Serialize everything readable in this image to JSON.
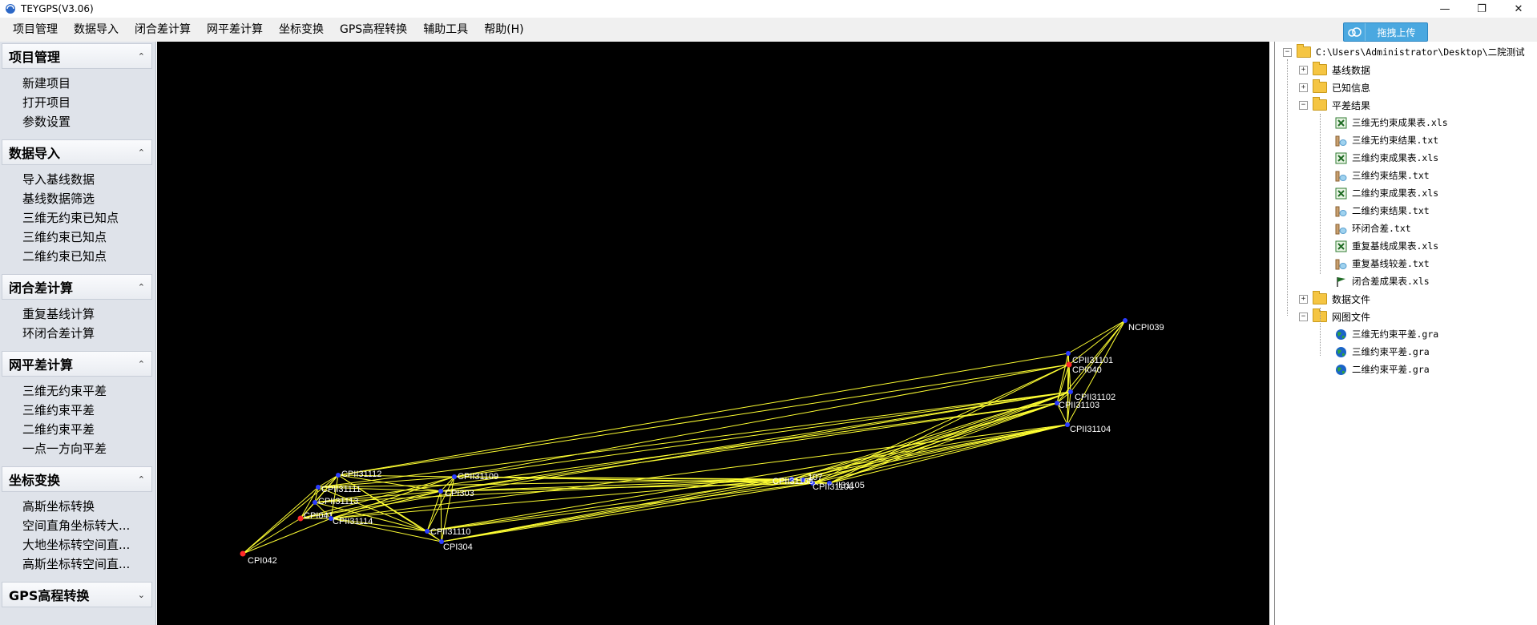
{
  "window": {
    "title": "TEYGPS(V3.06)",
    "controls": [
      "minimize",
      "maximize",
      "close"
    ]
  },
  "menubar": {
    "items": [
      "项目管理",
      "数据导入",
      "闭合差计算",
      "网平差计算",
      "坐标变换",
      "GPS高程转换",
      "辅助工具",
      "帮助(H)"
    ],
    "upload_label": "拖拽上传"
  },
  "sidebar": {
    "sections": [
      {
        "title": "项目管理",
        "items": [
          "新建项目",
          "打开项目",
          "参数设置"
        ]
      },
      {
        "title": "数据导入",
        "items": [
          "导入基线数据",
          "基线数据筛选",
          "三维无约束已知点",
          "三维约束已知点",
          "二维约束已知点"
        ]
      },
      {
        "title": "闭合差计算",
        "items": [
          "重复基线计算",
          "环闭合差计算"
        ]
      },
      {
        "title": "网平差计算",
        "items": [
          "三维无约束平差",
          "三维约束平差",
          "二维约束平差",
          "一点一方向平差"
        ]
      },
      {
        "title": "坐标变换",
        "items": [
          "高斯坐标转换",
          "空间直角坐标转大...",
          "大地坐标转空间直...",
          "高斯坐标转空间直..."
        ]
      },
      {
        "title": "GPS高程转换",
        "items": []
      }
    ]
  },
  "tree": {
    "root": "C:\\Users\\Administrator\\Desktop\\二院测试",
    "nodes": [
      {
        "label": "基线数据",
        "kind": "folder",
        "level": 1,
        "expander": "+"
      },
      {
        "label": "已知信息",
        "kind": "folder",
        "level": 1,
        "expander": "+"
      },
      {
        "label": "平差结果",
        "kind": "folder",
        "level": 1,
        "expander": "-"
      },
      {
        "label": "三维无约束成果表.xls",
        "kind": "xls",
        "level": 2
      },
      {
        "label": "三维无约束结果.txt",
        "kind": "txt",
        "level": 2
      },
      {
        "label": "三维约束成果表.xls",
        "kind": "xls",
        "level": 2
      },
      {
        "label": "三维约束结果.txt",
        "kind": "txt",
        "level": 2
      },
      {
        "label": "二维约束成果表.xls",
        "kind": "xls",
        "level": 2
      },
      {
        "label": "二维约束结果.txt",
        "kind": "txt",
        "level": 2
      },
      {
        "label": "环闭合差.txt",
        "kind": "txt",
        "level": 2
      },
      {
        "label": "重复基线成果表.xls",
        "kind": "xls",
        "level": 2
      },
      {
        "label": "重复基线较差.txt",
        "kind": "txt",
        "level": 2
      },
      {
        "label": "闭合差成果表.xls",
        "kind": "flag",
        "level": 2
      },
      {
        "label": "数据文件",
        "kind": "folder",
        "level": 1,
        "expander": "+"
      },
      {
        "label": "网图文件",
        "kind": "folder",
        "level": 1,
        "expander": "-"
      },
      {
        "label": "三维无约束平差.gra",
        "kind": "globe",
        "level": 2
      },
      {
        "label": "三维约束平差.gra",
        "kind": "globe",
        "level": 2
      },
      {
        "label": "二维约束平差.gra",
        "kind": "globe",
        "level": 2
      }
    ]
  },
  "network": {
    "line_color": "#ffff33",
    "known_point_color": "#ff2a2a",
    "unknown_point_color": "#2a3cff",
    "label_color": "#ffffff",
    "points": [
      {
        "id": "NCPI039",
        "label": "NCPI039",
        "known": false
      },
      {
        "id": "CPII31101",
        "label": "CPII31101",
        "known": false
      },
      {
        "id": "CPI040",
        "label": "CPI040",
        "known": true
      },
      {
        "id": "CPII31102",
        "label": "CPII31102",
        "known": false
      },
      {
        "id": "CPII31103",
        "label": "CPII31103",
        "known": false
      },
      {
        "id": "CPII31104",
        "label": "CPII31104",
        "known": false
      },
      {
        "id": "CPII31105",
        "label": "II31105",
        "known": false
      },
      {
        "id": "CPII31106",
        "label": "CPII31106",
        "known": false
      },
      {
        "id": "CPII31107",
        "label": "107",
        "known": false
      },
      {
        "id": "CPII31108",
        "label": "CPII31108",
        "known": false
      },
      {
        "id": "CPII31109",
        "label": "CPII31109",
        "known": false
      },
      {
        "id": "CPI303",
        "label": "CPI303",
        "known": false
      },
      {
        "id": "CPII31110",
        "label": "CPII31110",
        "known": false
      },
      {
        "id": "CPI304",
        "label": "CPI304",
        "known": false
      },
      {
        "id": "CPII31112",
        "label": "CPII31112",
        "known": false
      },
      {
        "id": "CPII31111",
        "label": "CPII31111",
        "known": false
      },
      {
        "id": "CPII31113",
        "label": "CPII31113",
        "known": false
      },
      {
        "id": "CPI041",
        "label": "CPI041",
        "known": true
      },
      {
        "id": "CPII31114",
        "label": "CPII31114",
        "known": false
      },
      {
        "id": "CPI042",
        "label": "CPI042",
        "known": true
      }
    ],
    "baselines": [
      [
        "CPI042",
        "CPI041"
      ],
      [
        "CPI042",
        "CPII31111"
      ],
      [
        "CPI042",
        "CPII31112"
      ],
      [
        "CPI042",
        "CPII31114"
      ],
      [
        "CPI041",
        "CPII31111"
      ],
      [
        "CPI041",
        "CPII31112"
      ],
      [
        "CPI041",
        "CPII31113"
      ],
      [
        "CPI041",
        "CPII31114"
      ],
      [
        "CPI041",
        "CPI303"
      ],
      [
        "CPI041",
        "CPII31109"
      ],
      [
        "CPII31111",
        "CPII31112"
      ],
      [
        "CPII31111",
        "CPII31113"
      ],
      [
        "CPII31111",
        "CPI303"
      ],
      [
        "CPII31111",
        "CPII31109"
      ],
      [
        "CPII31111",
        "CPII31110"
      ],
      [
        "CPII31112",
        "CPII31113"
      ],
      [
        "CPII31112",
        "CPII31114"
      ],
      [
        "CPII31112",
        "CPI303"
      ],
      [
        "CPII31112",
        "CPII31109"
      ],
      [
        "CPII31112",
        "CPII31110"
      ],
      [
        "CPII31112",
        "CPI304"
      ],
      [
        "CPII31113",
        "CPII31114"
      ],
      [
        "CPII31113",
        "CPI303"
      ],
      [
        "CPII31113",
        "CPII31110"
      ],
      [
        "CPII31114",
        "CPI303"
      ],
      [
        "CPII31114",
        "CPII31110"
      ],
      [
        "CPII31114",
        "CPI304"
      ],
      [
        "CPII31114",
        "CPII31109"
      ],
      [
        "CPI303",
        "CPII31109"
      ],
      [
        "CPI303",
        "CPII31110"
      ],
      [
        "CPI303",
        "CPI304"
      ],
      [
        "CPII31109",
        "CPII31110"
      ],
      [
        "CPII31109",
        "CPI304"
      ],
      [
        "CPII31110",
        "CPI304"
      ],
      [
        "CPII31109",
        "CPII31108"
      ],
      [
        "CPII31109",
        "CPII31107"
      ],
      [
        "CPII31109",
        "CPII31106"
      ],
      [
        "CPII31109",
        "CPII31105"
      ],
      [
        "CPI303",
        "CPII31108"
      ],
      [
        "CPI303",
        "CPII31106"
      ],
      [
        "CPI303",
        "CPII31105"
      ],
      [
        "CPII31110",
        "CPII31108"
      ],
      [
        "CPII31110",
        "CPII31106"
      ],
      [
        "CPI304",
        "CPII31108"
      ],
      [
        "CPI304",
        "CPII31107"
      ],
      [
        "CPI304",
        "CPII31106"
      ],
      [
        "CPII31113",
        "CPII31108"
      ],
      [
        "CPII31114",
        "CPII31108"
      ],
      [
        "CPII31111",
        "CPII31108"
      ],
      [
        "CPII31108",
        "CPII31107"
      ],
      [
        "CPII31108",
        "CPII31106"
      ],
      [
        "CPII31108",
        "CPII31105"
      ],
      [
        "CPII31107",
        "CPII31106"
      ],
      [
        "CPII31107",
        "CPII31105"
      ],
      [
        "CPII31106",
        "CPII31105"
      ],
      [
        "CPII31108",
        "CPII31104"
      ],
      [
        "CPII31108",
        "CPII31103"
      ],
      [
        "CPII31108",
        "CPII31102"
      ],
      [
        "CPII31107",
        "CPII31104"
      ],
      [
        "CPII31107",
        "CPII31103"
      ],
      [
        "CPII31107",
        "CPII31102"
      ],
      [
        "CPII31106",
        "CPII31104"
      ],
      [
        "CPII31106",
        "CPII31103"
      ],
      [
        "CPII31106",
        "CPII31102"
      ],
      [
        "CPII31106",
        "CPI040"
      ],
      [
        "CPII31105",
        "CPII31104"
      ],
      [
        "CPII31105",
        "CPII31103"
      ],
      [
        "CPII31105",
        "CPII31102"
      ],
      [
        "CPII31105",
        "CPI040"
      ],
      [
        "CPII31101",
        "CPI040"
      ],
      [
        "CPII31101",
        "CPII31102"
      ],
      [
        "CPII31101",
        "CPII31103"
      ],
      [
        "CPII31101",
        "CPII31104"
      ],
      [
        "CPII31101",
        "NCPI039"
      ],
      [
        "NCPI039",
        "CPI040"
      ],
      [
        "NCPI039",
        "CPII31102"
      ],
      [
        "NCPI039",
        "CPII31103"
      ],
      [
        "NCPI039",
        "CPII31104"
      ],
      [
        "CPI040",
        "CPII31102"
      ],
      [
        "CPI040",
        "CPII31103"
      ],
      [
        "CPI040",
        "CPII31104"
      ],
      [
        "CPII31102",
        "CPII31103"
      ],
      [
        "CPII31102",
        "CPII31104"
      ],
      [
        "CPII31103",
        "CPII31104"
      ],
      [
        "CPII31112",
        "CPI040"
      ],
      [
        "CPII31112",
        "CPII31101"
      ],
      [
        "CPII31111",
        "CPII31102"
      ],
      [
        "CPII31113",
        "CPII31103"
      ],
      [
        "CPII31114",
        "CPII31104"
      ],
      [
        "CPI041",
        "CPII31102"
      ],
      [
        "CPII31109",
        "CPII31102"
      ],
      [
        "CPI303",
        "CPII31103"
      ],
      [
        "CPII31110",
        "CPII31104"
      ],
      [
        "CPI304",
        "CPII31104"
      ],
      [
        "CPII31109",
        "CPI040"
      ],
      [
        "CPI303",
        "CPII31102"
      ]
    ]
  }
}
